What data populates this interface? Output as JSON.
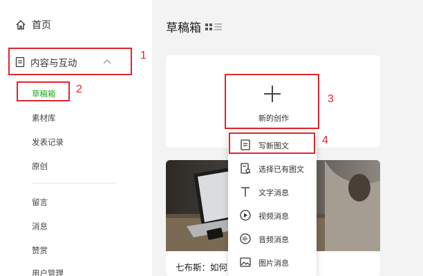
{
  "sidebar": {
    "home_label": "首页",
    "section_label": "内容与互动",
    "items": [
      {
        "label": "草稿箱"
      },
      {
        "label": "素材库"
      },
      {
        "label": "发表记录"
      },
      {
        "label": "原创"
      },
      {
        "label": "留言"
      },
      {
        "label": "消息"
      },
      {
        "label": "赞赏"
      },
      {
        "label": "用户管理"
      }
    ],
    "active_color": "#1aad19"
  },
  "main": {
    "title": "草稿箱",
    "new_label": "新的创作",
    "article_title": "七布斯：如何建立社群？"
  },
  "menu": {
    "items": [
      {
        "label": "写新图文",
        "icon": "document-icon"
      },
      {
        "label": "选择已有图文",
        "icon": "document-search-icon"
      },
      {
        "label": "文字消息",
        "icon": "text-icon"
      },
      {
        "label": "视频消息",
        "icon": "play-circle-icon"
      },
      {
        "label": "音频消息",
        "icon": "audio-icon"
      },
      {
        "label": "图片消息",
        "icon": "image-icon"
      }
    ]
  },
  "annotations": {
    "color": "#e0242a",
    "labels": [
      "1",
      "2",
      "3",
      "4"
    ]
  }
}
